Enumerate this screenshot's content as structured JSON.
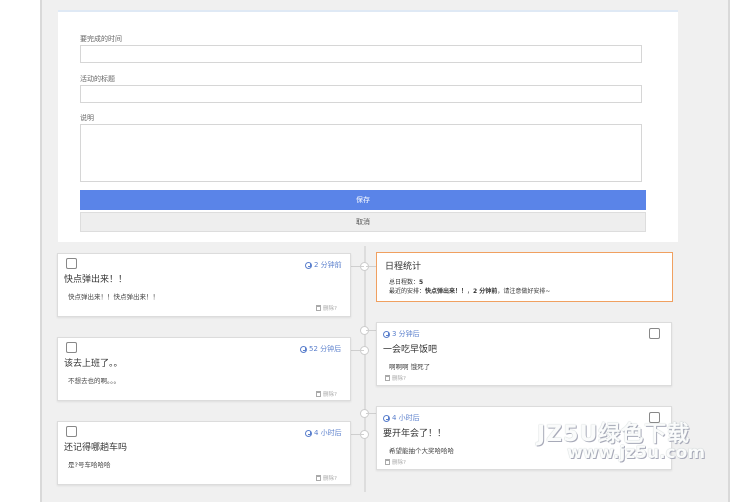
{
  "form": {
    "field1_label": "要完成的时间",
    "field2_label": "活动的标题",
    "field3_label": "说明",
    "save_label": "保存",
    "cancel_label": "取消"
  },
  "stats": {
    "title": "日程统计",
    "total_label": "总日程数：",
    "total_value": "5",
    "recent_prefix": "最近的安排：",
    "recent_title": "快点弹出来！！",
    "recent_sep": "，",
    "recent_time": "2 分钟前",
    "recent_suffix": "，请注意做好安排~"
  },
  "left_cards": [
    {
      "time": "2 分钟前",
      "title": "快点弹出来！！",
      "desc": "快点弹出来！！快点弹出来！！",
      "delete": "删除?"
    },
    {
      "time": "52 分钟后",
      "title": "该去上班了。。",
      "desc": "不想去也的啊。。。",
      "delete": "删除?"
    },
    {
      "time": "4 小时后",
      "title": "还记得哪趟车吗",
      "desc": "是?号车哈哈哈",
      "delete": "删除?"
    }
  ],
  "right_cards": [
    {
      "time": "3 分钟后",
      "title": "一会吃早饭吧",
      "desc": "啊啊啊 饿死了",
      "delete": "删除?"
    },
    {
      "time": "4 小时后",
      "title": "要开年会了！！",
      "desc": "希望能抽个大奖哈哈哈",
      "delete": "删除?"
    }
  ],
  "watermark": {
    "line1": "JZ5U绿色下载",
    "line2": "www.jz5u.com"
  }
}
